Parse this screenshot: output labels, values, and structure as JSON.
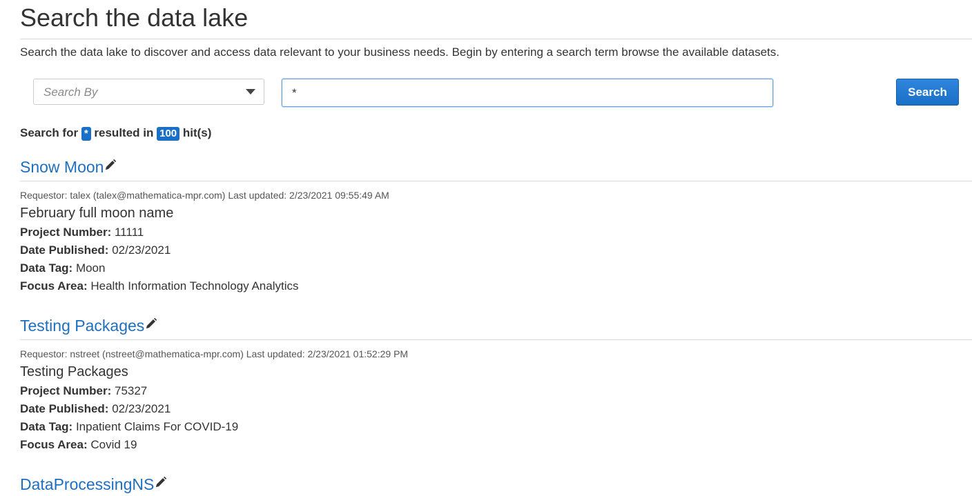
{
  "header": {
    "title": "Search the data lake",
    "intro": "Search the data lake to discover and access data relevant to your business needs. Begin by entering a search term browse the available datasets."
  },
  "search": {
    "search_by_placeholder": "Search By",
    "query": "*",
    "button_label": "Search"
  },
  "summary": {
    "prefix": "Search for",
    "term": "*",
    "middle": "resulted in",
    "hits": "100",
    "suffix": "hit(s)"
  },
  "labels": {
    "project_number": "Project Number:",
    "date_published": "Date Published:",
    "data_tag": "Data Tag:",
    "focus_area": "Focus Area:"
  },
  "results": [
    {
      "title": "Snow Moon",
      "meta": "Requestor: talex (talex@mathematica-mpr.com) Last updated: 2/23/2021 09:55:49 AM",
      "description": "February full moon name",
      "project_number": "11111",
      "date_published": "02/23/2021",
      "data_tag": "Moon",
      "focus_area": "Health Information Technology Analytics"
    },
    {
      "title": "Testing Packages",
      "meta": "Requestor: nstreet (nstreet@mathematica-mpr.com) Last updated: 2/23/2021 01:52:29 PM",
      "description": "Testing Packages",
      "project_number": "75327",
      "date_published": "02/23/2021",
      "data_tag": "Inpatient Claims For COVID-19",
      "focus_area": "Covid 19"
    },
    {
      "title": "DataProcessingNS"
    }
  ],
  "icons": {
    "edit": "pencil-icon",
    "dropdown": "caret-down-icon"
  },
  "colors": {
    "accent": "#1a6fc6",
    "link": "#1f6fbf",
    "text": "#333333"
  }
}
